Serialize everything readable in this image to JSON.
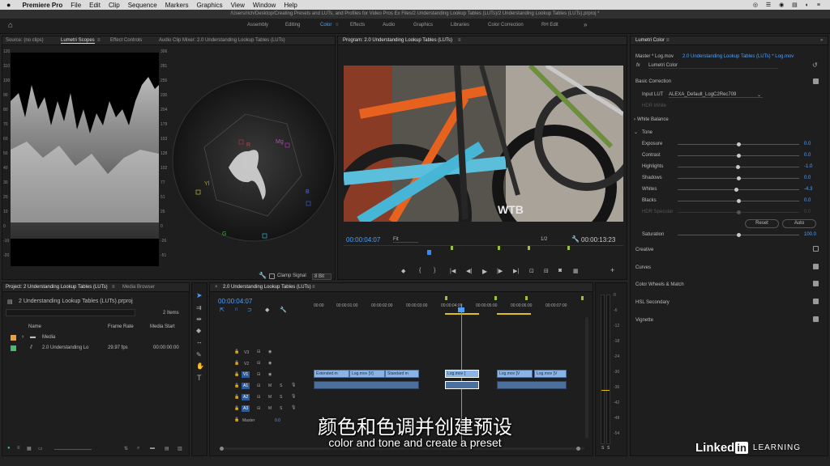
{
  "menubar": {
    "app": "Premiere Pro",
    "items": [
      "File",
      "Edit",
      "Clip",
      "Sequence",
      "Markers",
      "Graphics",
      "View",
      "Window",
      "Help"
    ]
  },
  "path": "/Users/rich/Desktop/Creating Presets and LUTs, and Profiles for Video Pros Ex Files/2 Understanding Lookup Tables (LUTs)/2 Understanding Lookup Tables (LUTs).prproj *",
  "workspaces": {
    "items": [
      "Assembly",
      "Editing",
      "Color",
      "Effects",
      "Audio",
      "Graphics",
      "Libraries",
      "Color Correction",
      "RH Edit"
    ],
    "active": "Color"
  },
  "source_panel": {
    "tabs": [
      "Source: (no clips)",
      "Lumetri Scopes",
      "Effect Controls",
      "Audio Clip Mixer: 2.0 Understanding Lookup Tables (LUTs)"
    ],
    "left_scale": [
      "120",
      "110",
      "100",
      "90",
      "80",
      "70",
      "60",
      "50",
      "40",
      "30",
      "20",
      "10",
      "0",
      "-10",
      "-20"
    ],
    "right_scale": [
      "306",
      "281",
      "255",
      "230",
      "204",
      "179",
      "153",
      "128",
      "102",
      "77",
      "51",
      "26",
      "0",
      "-26",
      "-51"
    ],
    "vector_labels": {
      "r": "R",
      "mg": "Mg",
      "b": "B",
      "cy": "Cy",
      "g": "G",
      "yl": "Yl"
    },
    "clamp_label": "Clamp Signal",
    "bit_depth": "8 Bit"
  },
  "program": {
    "title": "Program: 2.0 Understanding Lookup Tables (LUTs)",
    "timecode": "00:00:04:07",
    "fit": "Fit",
    "resolution": "1/2",
    "duration": "00:00:13:23"
  },
  "lumetri": {
    "title": "Lumetri Color",
    "master": "Master * Log.mov",
    "clip_link": "2.0 Understanding Lookup Tables (LUTs) * Log.mov",
    "fx": "fx",
    "effect": "Lumetri Color",
    "basic_correction": "Basic Correction",
    "input_lut_label": "Input LUT",
    "input_lut_value": "ALEXA_Default_LogC2Rec709",
    "hdr_white": "HDR White",
    "white_balance": "White Balance",
    "tone": "Tone",
    "sliders": [
      {
        "label": "Exposure",
        "value": "0.0",
        "pos": 0.5,
        "dim": false
      },
      {
        "label": "Contrast",
        "value": "0.0",
        "pos": 0.5,
        "dim": false
      },
      {
        "label": "Highlights",
        "value": "-1.0",
        "pos": 0.49,
        "dim": false
      },
      {
        "label": "Shadows",
        "value": "0.0",
        "pos": 0.5,
        "dim": false
      },
      {
        "label": "Whites",
        "value": "-4.3",
        "pos": 0.48,
        "dim": false
      },
      {
        "label": "Blacks",
        "value": "0.0",
        "pos": 0.5,
        "dim": false
      },
      {
        "label": "HDR Specular",
        "value": "0.0",
        "pos": 0.5,
        "dim": true
      }
    ],
    "reset": "Reset",
    "auto": "Auto",
    "saturation_label": "Saturation",
    "saturation_value": "100.0",
    "sections": [
      "Creative",
      "Curves",
      "Color Wheels & Match",
      "HSL Secondary",
      "Vignette"
    ]
  },
  "project": {
    "tabs": [
      "Project: 2 Understanding Lookup Tables (LUTs)",
      "Media Browser"
    ],
    "name": "2 Understanding Lookup Tables (LUTs).prproj",
    "items_count": "2 Items",
    "columns": [
      "Name",
      "Frame Rate",
      "Media Start"
    ],
    "rows": [
      {
        "name": "Media",
        "rate": "",
        "start": "",
        "color": "#e8a040"
      },
      {
        "name": "2.0 Understanding Lo",
        "rate": "29.97 fps",
        "start": "00:00:00:00",
        "color": "#3fbf6f"
      }
    ]
  },
  "timeline": {
    "title": "2.0 Understanding Lookup Tables (LUTs)",
    "timecode": "00:00:04:07",
    "ruler": [
      "00:00",
      "00:00:01:00",
      "00:00:02:00",
      "00:00:03:00",
      "00:00:04:00",
      "00:00:05:00",
      "00:00:06:00",
      "00:00:07:00"
    ],
    "video_tracks": [
      "V3",
      "V2",
      "V1"
    ],
    "audio_tracks": [
      "A1",
      "A2",
      "A3"
    ],
    "master": "Master",
    "master_value": "0.0",
    "clips": [
      "Extended m",
      "Log.mov [V]",
      "Standard m",
      "Log.mov [",
      "Log.mov [V",
      "Log.mov [V"
    ]
  },
  "meter_scale": [
    "0",
    "-6",
    "-12",
    "-18",
    "-24",
    "-30",
    "-36",
    "-42",
    "-48",
    "-54"
  ],
  "meter_bottom": [
    "S",
    "S"
  ],
  "subtitles": {
    "zh": "颜色和色调并创建预设",
    "en": "color and tone and create a preset"
  },
  "watermark": {
    "text1": "Linked",
    "text2": "in",
    "text3": "LEARNING"
  }
}
